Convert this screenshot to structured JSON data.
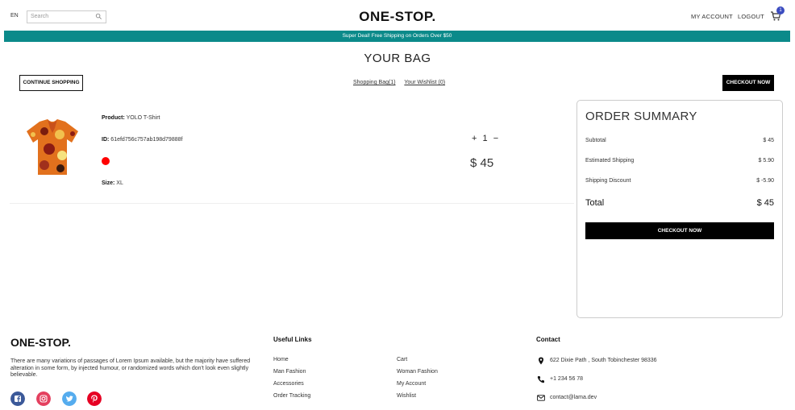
{
  "nav": {
    "lang": "EN",
    "search_placeholder": "Search",
    "logo": "ONE-STOP.",
    "my_account": "MY ACCOUNT",
    "logout": "LOGOUT",
    "cart_count": "1"
  },
  "announcement": "Super Deal! Free Shipping on Orders Over $50",
  "bag": {
    "title": "YOUR BAG",
    "continue_label": "CONTINUE SHOPPING",
    "tabs": [
      "Shopping Bag(1)",
      "Your Wishlist (0)"
    ],
    "checkout_label": "CHECKOUT NOW"
  },
  "product": {
    "name_label": "Product:",
    "name": "YOLO T-Shirt",
    "id_label": "ID:",
    "id": "61efd756c757ab198d79888f",
    "color": "#ff0000",
    "size_label": "Size:",
    "size": "XL",
    "plus": "+",
    "quantity": "1",
    "minus": "−",
    "price": "$ 45"
  },
  "summary": {
    "title": "ORDER SUMMARY",
    "rows": [
      {
        "label": "Subtotal",
        "value": "$ 45"
      },
      {
        "label": "Estimated Shipping",
        "value": "$ 5.90"
      },
      {
        "label": "Shipping Discount",
        "value": "$ -5.90"
      }
    ],
    "total_label": "Total",
    "total_value": "$ 45",
    "checkout_label": "CHECKOUT NOW"
  },
  "footer": {
    "logo": "ONE-STOP.",
    "description": "There are many variations of passages of Lorem Ipsum available, but the majority have suffered alteration in some form, by injected humour, or randomized words which don't look even slightly believable.",
    "useful_links_title": "Useful Links",
    "links_col1": [
      "Home",
      "Man Fashion",
      "Accessories",
      "Order Tracking"
    ],
    "links_col2": [
      "Cart",
      "Woman Fashion",
      "My Account",
      "Wishlist"
    ],
    "contact_title": "Contact",
    "address": "622 Dixie Path , South Tobinchester 98336",
    "phone": "+1 234 56 78",
    "email": "contact@lama.dev",
    "social": [
      {
        "icon": "facebook-icon",
        "color": "#3b5999"
      },
      {
        "icon": "instagram-icon",
        "color": "#e4405f"
      },
      {
        "icon": "twitter-icon",
        "color": "#55acee"
      },
      {
        "icon": "pinterest-icon",
        "color": "#e60023"
      }
    ]
  },
  "colors": {
    "announcement_bg": "#0b8a8a",
    "cart_badge": "#3b4cc0",
    "button_dark": "#000000"
  }
}
